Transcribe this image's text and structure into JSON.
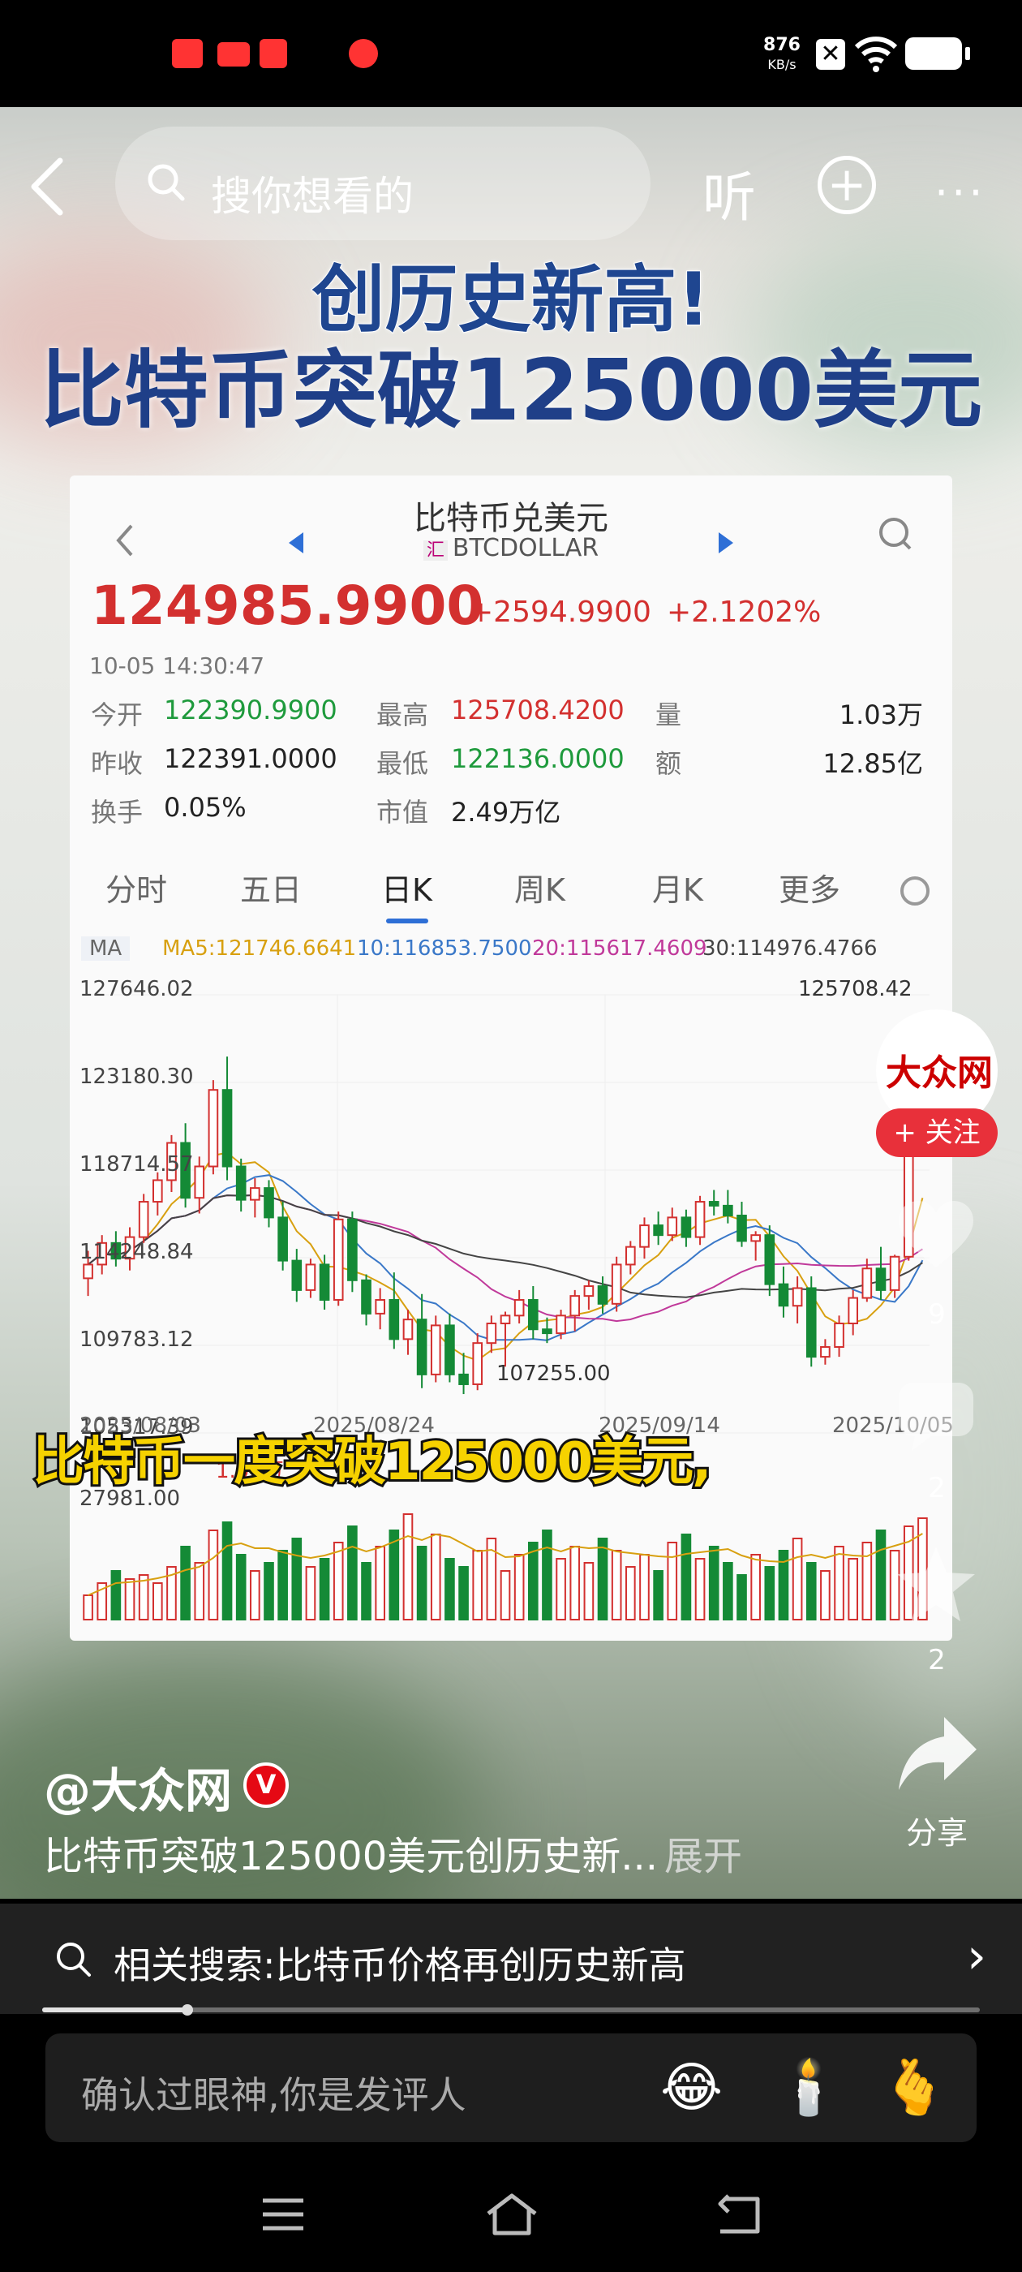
{
  "status_bar": {
    "network_speed": "876",
    "network_unit": "KB/s",
    "sim_icon": "sim-off-icon",
    "wifi_icon": "wifi-icon",
    "battery_icon": "battery-icon"
  },
  "top_nav": {
    "search_placeholder": "搜你想看的",
    "listen_label": "听"
  },
  "video": {
    "headline_line1": "创历史新高!",
    "headline_line2": "比特币突破125000美元",
    "subtitle": "比特币一度突破125000美元,"
  },
  "quote": {
    "title": "比特币兑美元",
    "symbol_tag": "汇",
    "symbol": "BTCDOLLAR",
    "last_price": "124985.9900",
    "change": "+2594.9900",
    "change_pct": "+2.1202%",
    "timestamp": "10-05 14:30:47",
    "stats": [
      {
        "label": "今开",
        "value": "122390.9900",
        "tone": "green"
      },
      {
        "label": "最高",
        "value": "125708.4200",
        "tone": "red"
      },
      {
        "label": "量",
        "value": "1.03万",
        "tone": "dark"
      },
      {
        "label": "昨收",
        "value": "122391.0000",
        "tone": "dark"
      },
      {
        "label": "最低",
        "value": "122136.0000",
        "tone": "green"
      },
      {
        "label": "额",
        "value": "12.85亿",
        "tone": "dark"
      },
      {
        "label": "换手",
        "value": "0.05%",
        "tone": "dark"
      },
      {
        "label": "市值",
        "value": "2.49万亿",
        "tone": "dark"
      }
    ],
    "tabs": [
      "分时",
      "五日",
      "日K",
      "周K",
      "月K",
      "更多"
    ],
    "active_tab": "日K",
    "ma_label": "MA",
    "ma_values": [
      {
        "text": "MA5:121746.6641",
        "color": "#d8a010"
      },
      {
        "text": "10:116853.7500",
        "color": "#3a78c8"
      },
      {
        "text": "20:115617.4609",
        "color": "#c0399a"
      },
      {
        "text": "30:114976.4766",
        "color": "#444444"
      }
    ]
  },
  "chart_data": {
    "type": "candlestick",
    "y_ticks": [
      "127646.02",
      "123180.30",
      "118714.57",
      "114248.84",
      "109783.12",
      "105317.39"
    ],
    "ylim": [
      105317.39,
      127646.02
    ],
    "x_ticks": [
      "2025/08/03",
      "2025/08/24",
      "2025/09/14",
      "2025/10/05"
    ],
    "annotations": [
      "125708.42",
      "107255.00"
    ],
    "candles": [
      [
        113200,
        114600,
        112300,
        113900
      ],
      [
        113900,
        115400,
        113400,
        115000
      ],
      [
        115000,
        115600,
        113800,
        114200
      ],
      [
        114200,
        115800,
        113600,
        115300
      ],
      [
        115300,
        117500,
        115000,
        117100
      ],
      [
        117100,
        118600,
        116400,
        118200
      ],
      [
        118200,
        120500,
        117600,
        120100
      ],
      [
        120100,
        121100,
        116800,
        117300
      ],
      [
        117300,
        119400,
        116500,
        118900
      ],
      [
        118900,
        123300,
        118500,
        122800
      ],
      [
        122800,
        124500,
        118200,
        118900
      ],
      [
        118900,
        119300,
        116600,
        117200
      ],
      [
        117200,
        118300,
        116300,
        117800
      ],
      [
        117800,
        118200,
        115800,
        116300
      ],
      [
        116300,
        117100,
        113600,
        114100
      ],
      [
        114100,
        114700,
        112000,
        112600
      ],
      [
        112600,
        114200,
        112200,
        113900
      ],
      [
        113900,
        114400,
        111600,
        112100
      ],
      [
        112100,
        116600,
        111800,
        116200
      ],
      [
        116200,
        116600,
        112500,
        113100
      ],
      [
        113100,
        113400,
        110800,
        111400
      ],
      [
        111400,
        112700,
        110600,
        112100
      ],
      [
        112100,
        113500,
        109600,
        110100
      ],
      [
        110100,
        111600,
        109300,
        111100
      ],
      [
        111100,
        112400,
        107600,
        108300
      ],
      [
        108300,
        111300,
        107900,
        110800
      ],
      [
        110800,
        111400,
        107900,
        108300
      ],
      [
        108300,
        109400,
        107300,
        107800
      ],
      [
        107800,
        110400,
        107500,
        109900
      ],
      [
        109900,
        111300,
        109400,
        110900
      ],
      [
        110900,
        111500,
        108700,
        111300
      ],
      [
        111300,
        112600,
        110900,
        112100
      ],
      [
        112100,
        112800,
        110100,
        110600
      ],
      [
        110600,
        111200,
        109900,
        110400
      ],
      [
        110400,
        111600,
        110100,
        111300
      ],
      [
        111300,
        112600,
        110500,
        112300
      ],
      [
        112300,
        113100,
        111600,
        112800
      ],
      [
        112800,
        113300,
        111400,
        111900
      ],
      [
        111900,
        114300,
        111500,
        113900
      ],
      [
        113900,
        115100,
        113400,
        114800
      ],
      [
        114800,
        116300,
        114200,
        115900
      ],
      [
        115900,
        116600,
        114900,
        115400
      ],
      [
        115400,
        116800,
        115100,
        116300
      ],
      [
        116300,
        116700,
        114800,
        115300
      ],
      [
        115300,
        117400,
        114900,
        117100
      ],
      [
        117100,
        117700,
        116400,
        116900
      ],
      [
        116900,
        117700,
        116000,
        116400
      ],
      [
        116400,
        117100,
        114800,
        115100
      ],
      [
        115100,
        115600,
        114100,
        115400
      ],
      [
        115400,
        115900,
        112300,
        112900
      ],
      [
        112900,
        113800,
        111200,
        111800
      ],
      [
        111800,
        113300,
        110900,
        112700
      ],
      [
        112700,
        113300,
        108700,
        109200
      ],
      [
        109200,
        110100,
        108800,
        109700
      ],
      [
        109700,
        111300,
        109200,
        110900
      ],
      [
        110900,
        112600,
        110300,
        112200
      ],
      [
        112200,
        114200,
        112000,
        113700
      ],
      [
        113700,
        114800,
        112100,
        112600
      ],
      [
        112600,
        114400,
        112200,
        114300
      ],
      [
        114300,
        121500,
        114100,
        120900
      ],
      [
        120900,
        125708,
        120500,
        124986
      ]
    ],
    "volume": {
      "y_tick": "27981.00",
      "label": "1.03万",
      "values": [
        6,
        9,
        12,
        10,
        11,
        9,
        13,
        18,
        14,
        22,
        24,
        16,
        12,
        14,
        17,
        20,
        13,
        15,
        19,
        23,
        14,
        18,
        22,
        26,
        18,
        21,
        15,
        13,
        17,
        20,
        12,
        16,
        19,
        22,
        15,
        18,
        14,
        20,
        17,
        13,
        16,
        12,
        19,
        21,
        15,
        18,
        14,
        11,
        16,
        13,
        17,
        20,
        14,
        12,
        18,
        15,
        19,
        22,
        17,
        23,
        25
      ]
    }
  },
  "right_rail": {
    "follow_label": "+ 关注",
    "like_count": "9",
    "comment_count": "2",
    "favorite_count": "2",
    "share_label": "分享"
  },
  "post": {
    "author": "@大众网",
    "verified_badge": "V",
    "caption": "比特币突破125000美元创历史新...",
    "expand_label": "展开",
    "playback_progress": 0.155
  },
  "related": {
    "text": "相关搜索:比特币价格再创历史新高"
  },
  "comment": {
    "placeholder": "确认过眼神,你是发评人",
    "emojis": [
      "😂",
      "🕯️",
      "🫰"
    ]
  }
}
